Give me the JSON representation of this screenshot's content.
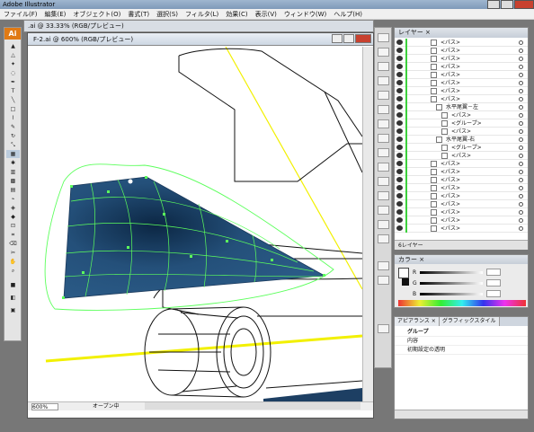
{
  "app": {
    "title": "Adobe Illustrator",
    "logo": "Ai"
  },
  "menubar": {
    "items": [
      "ファイル(F)",
      "編集(E)",
      "オブジェクト(O)",
      "書式(T)",
      "選択(S)",
      "フィルタ(L)",
      "効果(C)",
      "表示(V)",
      "ウィンドウ(W)",
      "ヘルプ(H)"
    ]
  },
  "background_doc": {
    "title": ".ai @ 33.33% (RGB/プレビュー)"
  },
  "document": {
    "title": "F-2.ai @ 600% (RGB/プレビュー)",
    "zoom": "600%",
    "status": "オープン中"
  },
  "layers_panel": {
    "tab": "レイヤー ×",
    "footer": "6レイヤー",
    "rows": [
      {
        "name": "<パス>",
        "indent": 0
      },
      {
        "name": "<パス>",
        "indent": 0
      },
      {
        "name": "<パス>",
        "indent": 0
      },
      {
        "name": "<パス>",
        "indent": 0
      },
      {
        "name": "<パス>",
        "indent": 0
      },
      {
        "name": "<パス>",
        "indent": 0
      },
      {
        "name": "<パス>",
        "indent": 0
      },
      {
        "name": "<パス>",
        "indent": 0
      },
      {
        "name": "水平尾翼－左",
        "indent": 1
      },
      {
        "name": "<パス>",
        "indent": 2
      },
      {
        "name": "<グループ>",
        "indent": 2
      },
      {
        "name": "<パス>",
        "indent": 2
      },
      {
        "name": "水平尾翼-右",
        "indent": 1
      },
      {
        "name": "<グループ>",
        "indent": 2
      },
      {
        "name": "<パス>",
        "indent": 2
      },
      {
        "name": "<パス>",
        "indent": 0
      },
      {
        "name": "<パス>",
        "indent": 0
      },
      {
        "name": "<パス>",
        "indent": 0
      },
      {
        "name": "<パス>",
        "indent": 0
      },
      {
        "name": "<パス>",
        "indent": 0
      },
      {
        "name": "<パス>",
        "indent": 0
      },
      {
        "name": "<パス>",
        "indent": 0
      },
      {
        "name": "<パス>",
        "indent": 0
      },
      {
        "name": "<パス>",
        "indent": 0
      }
    ]
  },
  "color_panel": {
    "tab": "カラー ×",
    "channels": [
      "R",
      "G",
      "B"
    ]
  },
  "appearance_panel": {
    "tabs": [
      "アピアランス ×",
      "グラフィックスタイル"
    ],
    "rows": [
      "グループ",
      "内容",
      "初期設定の透明"
    ]
  },
  "colors": {
    "selection": "#5cff5c",
    "wing_fill": "#1d3f63",
    "guide_yellow": "#f2f000"
  }
}
